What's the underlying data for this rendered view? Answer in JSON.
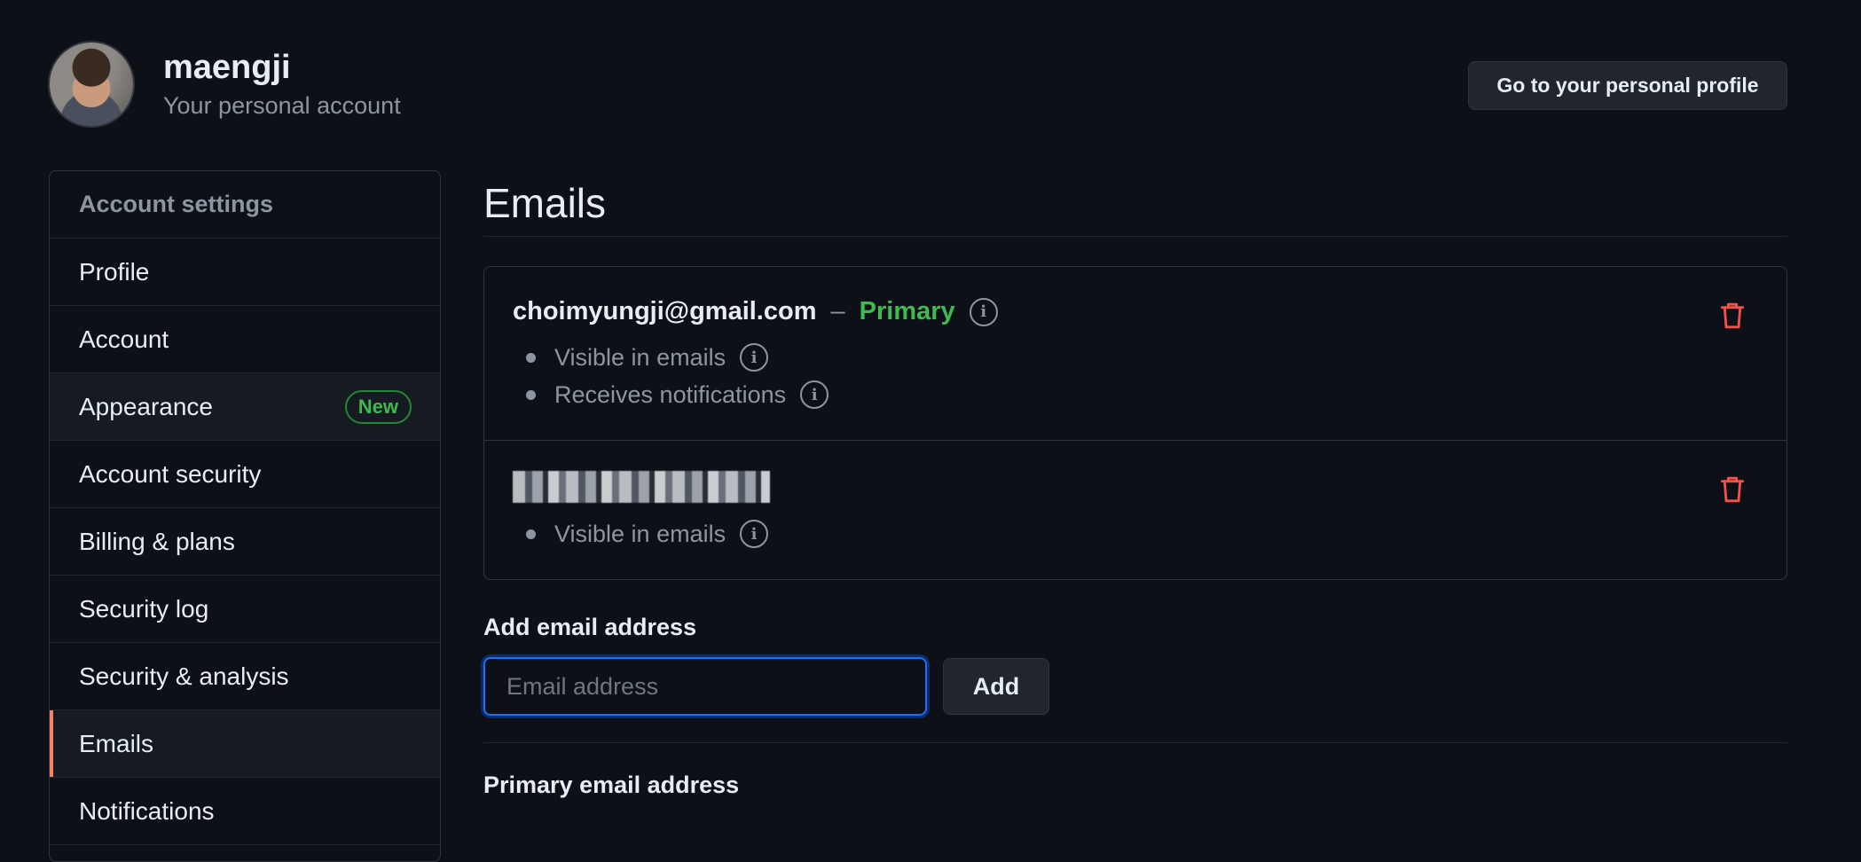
{
  "header": {
    "username": "maengji",
    "subtitle": "Your personal account",
    "profile_button": "Go to your personal profile"
  },
  "sidebar": {
    "heading": "Account settings",
    "items": [
      {
        "label": "Profile"
      },
      {
        "label": "Account"
      },
      {
        "label": "Appearance",
        "badge": "New"
      },
      {
        "label": "Account security"
      },
      {
        "label": "Billing & plans"
      },
      {
        "label": "Security log"
      },
      {
        "label": "Security & analysis"
      },
      {
        "label": "Emails",
        "selected": true
      },
      {
        "label": "Notifications"
      }
    ]
  },
  "main": {
    "title": "Emails",
    "emails": [
      {
        "address": "choimyungji@gmail.com",
        "separator": "–",
        "tag": "Primary",
        "properties": [
          "Visible in emails",
          "Receives notifications"
        ]
      },
      {
        "address": "",
        "properties": [
          "Visible in emails"
        ]
      }
    ],
    "add_email": {
      "label": "Add email address",
      "placeholder": "Email address",
      "button": "Add"
    },
    "primary_section_label": "Primary email address"
  },
  "colors": {
    "background": "#0d1117",
    "primary_green": "#3fb950",
    "danger_red": "#f85149",
    "selected_accent": "#f78166",
    "focus_blue": "#1f6feb"
  },
  "icons": [
    "avatar",
    "info-icon",
    "trash-icon"
  ]
}
